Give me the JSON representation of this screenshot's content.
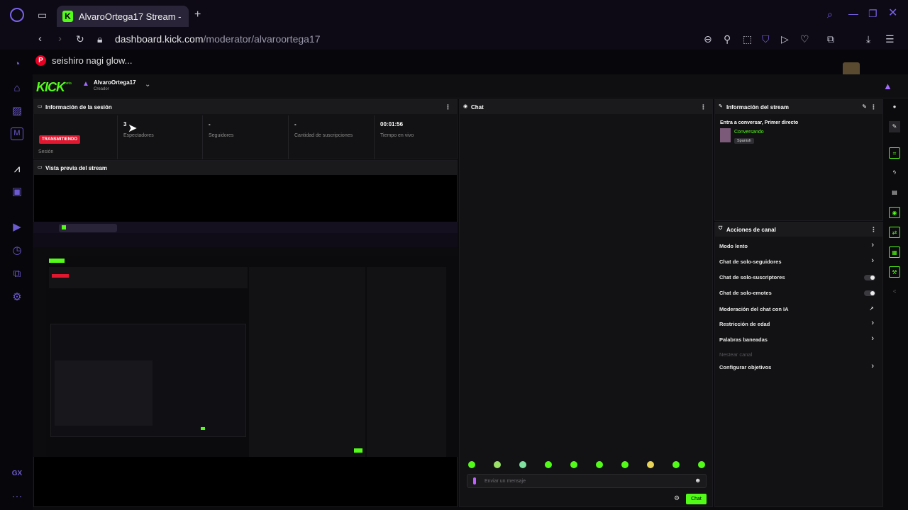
{
  "browser": {
    "tab_title": "AlvaroOrtega17 Stream - K",
    "url_host": "dashboard.kick.com",
    "url_path": "/moderator/alvaroortega17",
    "bookmark_label": "seishiro nagi glow..."
  },
  "header": {
    "logo": "KICK",
    "beta": "beta",
    "username": "AlvaroOrtega17",
    "role": "Creador"
  },
  "session": {
    "title": "Información de la sesión",
    "live_badge": "TRANSMITIENDO",
    "session_label": "Sesión",
    "stats": [
      {
        "value": "3",
        "label": "Espectadores"
      },
      {
        "value": "-",
        "label": "Seguidores"
      },
      {
        "value": "-",
        "label": "Cantidad de suscripciones"
      },
      {
        "value": "00:01:56",
        "label": "Tiempo en vivo"
      }
    ]
  },
  "preview": {
    "title": "Vista previa del stream"
  },
  "chat": {
    "title": "Chat",
    "placeholder": "Enviar un mensaje",
    "send_label": "Chat"
  },
  "stream_info": {
    "title": "Información del stream",
    "stream_title": "Entra a conversar, Primer directo",
    "category": "Conversando",
    "language": "Spanish"
  },
  "channel_actions": {
    "title": "Acciones de canal",
    "items": [
      {
        "label": "Modo lento",
        "control": "chevron"
      },
      {
        "label": "Chat de solo-seguidores",
        "control": "chevron"
      },
      {
        "label": "Chat de solo-suscriptores",
        "control": "toggle"
      },
      {
        "label": "Chat de solo-emotes",
        "control": "toggle"
      },
      {
        "label": "Moderación del chat con IA",
        "control": "external"
      },
      {
        "label": "Restricción de edad",
        "control": "chevron"
      },
      {
        "label": "Palabras baneadas",
        "control": "chevron"
      },
      {
        "label": "Nestear canal",
        "control": "none"
      },
      {
        "label": "Configurar objetivos",
        "control": "chevron"
      }
    ]
  },
  "sidebar_bottom": "GX",
  "colors": {
    "kick_green": "#53fc18",
    "live_red": "#e1162f",
    "opera_purple": "#6c5bd0"
  }
}
